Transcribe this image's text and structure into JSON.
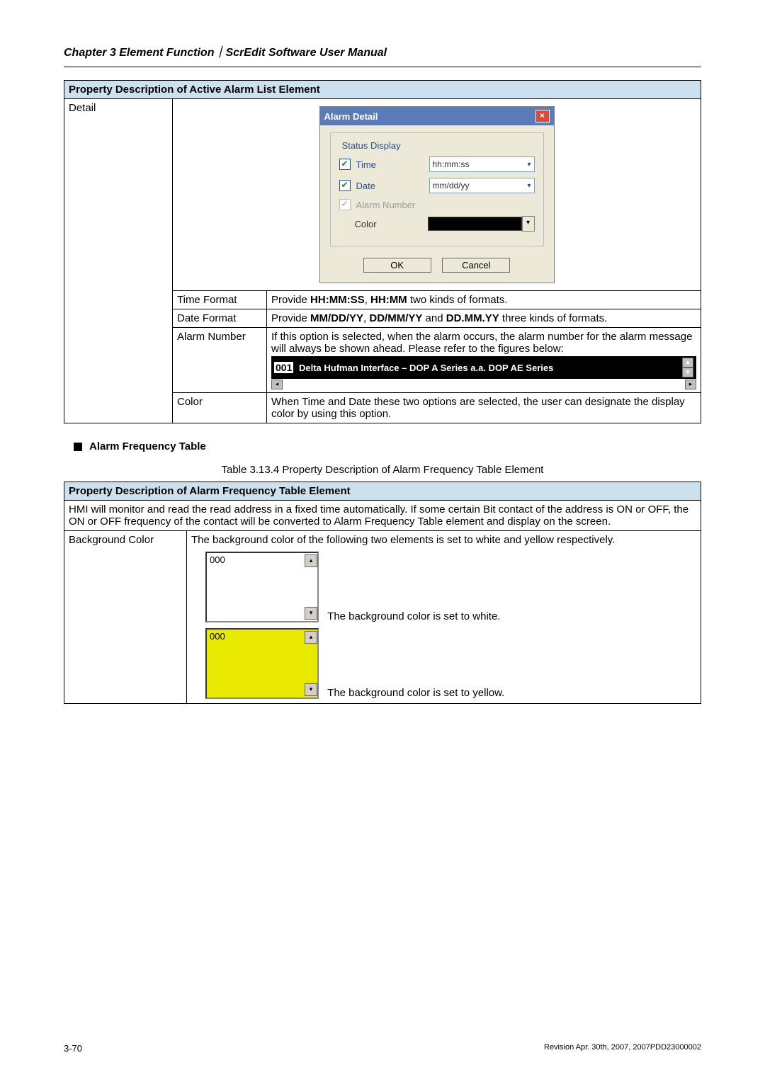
{
  "chapter_header": "Chapter 3  Element Function｜ScrEdit Software User Manual",
  "table1": {
    "header": "Property Description of Active Alarm List Element",
    "col_detail": "Detail",
    "dialog": {
      "title": "Alarm Detail",
      "legend": "Status Display",
      "time_label": "Time",
      "time_value": "hh:mm:ss",
      "date_label": "Date",
      "date_value": "mm/dd/yy",
      "alarm_number_label": "Alarm Number",
      "color_label": "Color",
      "ok": "OK",
      "cancel": "Cancel"
    },
    "rows": {
      "time_format_label": "Time Format",
      "time_format_prefix": "Provide ",
      "time_format_bold": "HH:MM:SS",
      "time_format_sep": ", ",
      "time_format_bold2": "HH:MM",
      "time_format_suffix": " two kinds of formats.",
      "date_format_label": "Date Format",
      "date_format_prefix": "Provide ",
      "date_format_b1": "MM/DD/YY",
      "date_format_s1": ", ",
      "date_format_b2": "DD/MM/YY",
      "date_format_s2": " and ",
      "date_format_b3": "DD.MM.YY",
      "date_format_suffix": " three kinds of formats.",
      "alarm_number_label": "Alarm Number",
      "alarm_number_text": "If this option is selected, when the alarm occurs, the alarm number for the alarm message will always be shown ahead. Please refer to the figures below:",
      "alarm_bar_num": "001",
      "alarm_bar_text": "Delta Hufman Interface – DOP A Series a.a. DOP AE Series",
      "color_label": "Color",
      "color_text": "When Time and Date these two options are selected, the user can designate the display color by using this option."
    }
  },
  "section_bullet": "Alarm Frequency Table",
  "table2_caption": "Table 3.13.4 Property Description of Alarm Frequency Table Element",
  "table2": {
    "header": "Property Description of Alarm Frequency Table Element",
    "intro": "HMI will monitor and read the read address in a fixed time automatically. If some certain Bit contact of the address is ON or OFF, the ON or OFF frequency of the contact will be converted to Alarm Frequency Table element and display on the screen.",
    "bgcolor_label": "Background Color",
    "bgcolor_intro": "The background color of the following two elements is set to white and yellow respectively.",
    "lb_value": "000",
    "white_caption": "The background color is set to white.",
    "yellow_caption": "The background color is set to yellow."
  },
  "footer_page": "3-70",
  "footer_rev": "Revision Apr. 30th, 2007, 2007PDD23000002"
}
